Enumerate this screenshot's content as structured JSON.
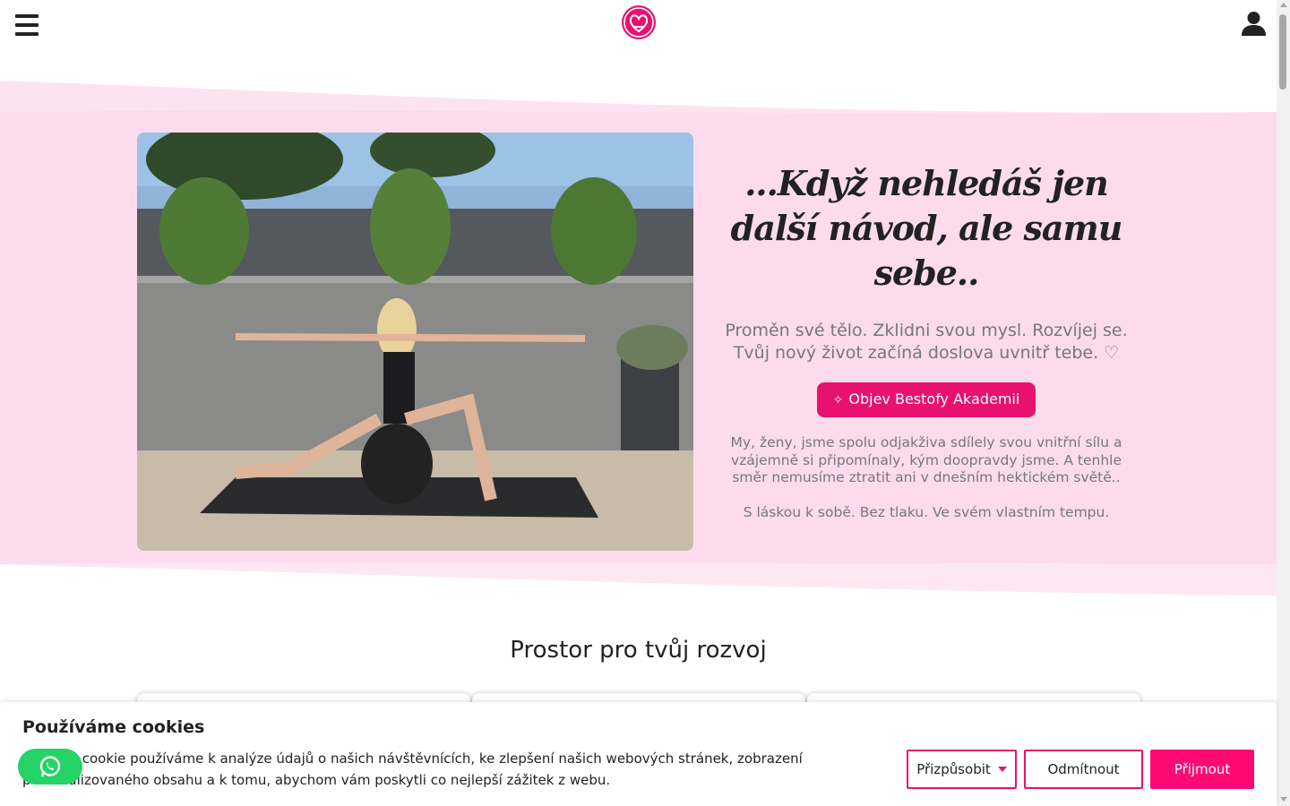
{
  "header": {
    "menu_icon": "hamburger-menu-icon",
    "logo_icon": "bestofy-heart-logo",
    "account_icon": "user-icon",
    "brand_color": "#e8116f"
  },
  "hero": {
    "image_alt": "woman-yoga-lunge-photo",
    "title": "...Když nehledáš jen další návod, ale samu sebe..",
    "subtitle": "Proměn své tělo. Zklidni svou mysl. Rozvíjej se. Tvůj nový život začíná doslova uvnitř tebe. ♡",
    "cta_icon": "sparkles-icon",
    "cta_label": "Objev Bestofy Akademii",
    "body": "My, ženy, jsme spolu odjakživa sdílely svou vnitřní sílu a vzájemně si připomínaly, kým doopravdy jsme. A tenhle směr nemusíme ztratit ani v dnešním hektickém světě..",
    "body2": "S láskou k sobě. Bez tlaku. Ve svém vlastním tempu."
  },
  "section": {
    "title": "Prostor pro tvůj rozvoj"
  },
  "cookie": {
    "title": "Používáme cookies",
    "text": "Soubory cookie používáme k analýze údajů o našich návštěvnících, ke zlepšení našich webových stránek, zobrazení personalizovaného obsahu a k tomu, abychom vám poskytli co nejlepší zážitek z webu.",
    "customize_label": "Přizpůsobit",
    "reject_label": "Odmítnout",
    "accept_label": "Přijmout"
  },
  "chat": {
    "icon": "whatsapp-icon"
  }
}
